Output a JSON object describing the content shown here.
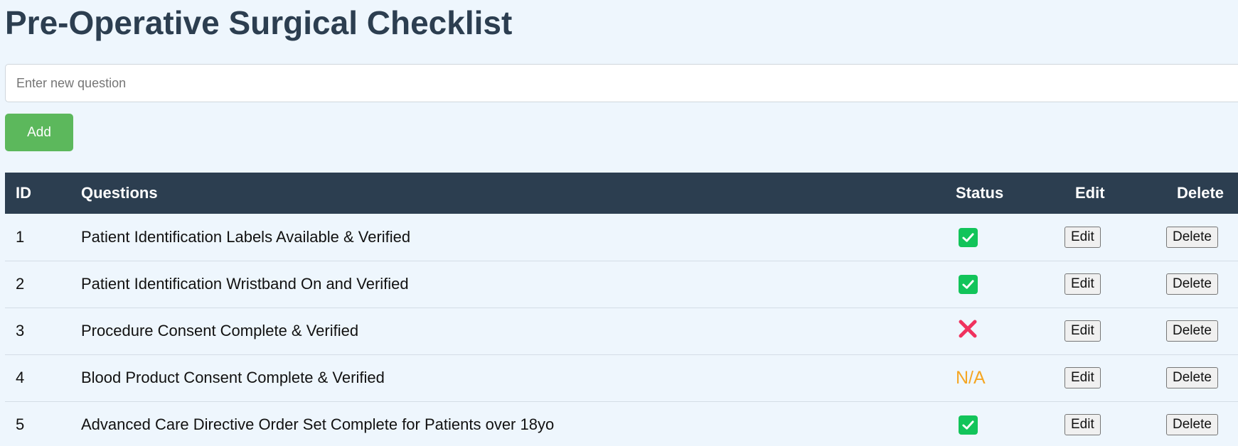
{
  "header": {
    "title": "Pre-Operative Surgical Checklist"
  },
  "form": {
    "placeholder": "Enter new question",
    "value": "",
    "add_label": "Add"
  },
  "table": {
    "headers": {
      "id": "ID",
      "questions": "Questions",
      "status": "Status",
      "edit": "Edit",
      "delete": "Delete"
    },
    "rows": [
      {
        "id": "1",
        "question": "Patient Identification Labels Available & Verified",
        "status": "check",
        "edit_label": "Edit",
        "delete_label": "Delete"
      },
      {
        "id": "2",
        "question": "Patient Identification Wristband On and Verified",
        "status": "check",
        "edit_label": "Edit",
        "delete_label": "Delete"
      },
      {
        "id": "3",
        "question": "Procedure Consent Complete & Verified",
        "status": "cross",
        "edit_label": "Edit",
        "delete_label": "Delete"
      },
      {
        "id": "4",
        "question": "Blood Product Consent Complete & Verified",
        "status": "na",
        "status_text": "N/A",
        "edit_label": "Edit",
        "delete_label": "Delete"
      },
      {
        "id": "5",
        "question": "Advanced Care Directive Order Set Complete for Patients over 18yo",
        "status": "check",
        "edit_label": "Edit",
        "delete_label": "Delete"
      }
    ]
  },
  "icons": {
    "check": "check-mark-icon",
    "cross": "cross-mark-icon"
  },
  "colors": {
    "header_bg": "#2c3e50",
    "title": "#2c3e50",
    "add_button": "#5cb85c",
    "check": "#12c45a",
    "cross": "#f0325e",
    "na": "#f5a623",
    "page_bg": "#eef6fd"
  }
}
